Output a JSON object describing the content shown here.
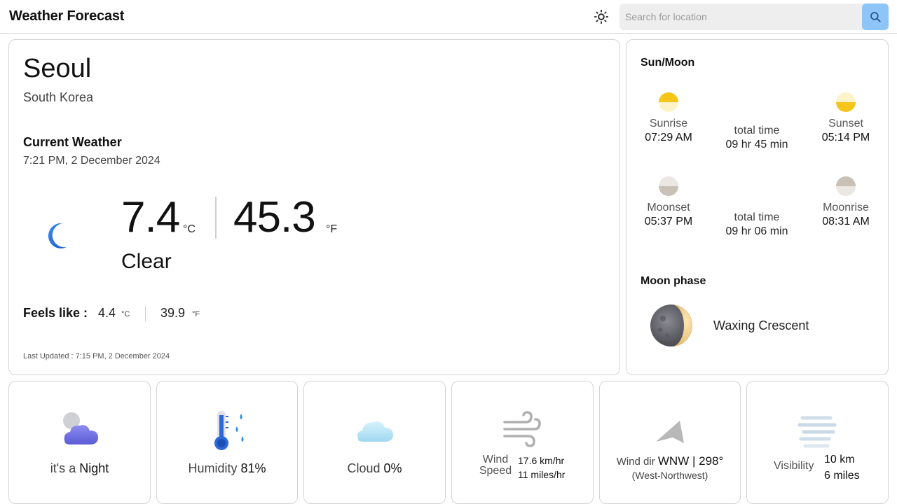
{
  "app": {
    "title": "Weather Forecast"
  },
  "header": {
    "theme_icon": "sun-icon",
    "search_placeholder": "Search for location",
    "search_icon": "search-icon",
    "search_button_color": "#8ec5f8"
  },
  "current": {
    "city": "Seoul",
    "country": "South Korea",
    "heading": "Current Weather",
    "datetime": "7:21 PM, 2 December 2024",
    "condition_icon": "crescent-moon-icon",
    "temp_c": "7.4",
    "unit_c": "°C",
    "temp_f": "45.3",
    "unit_f": "°F",
    "condition": "Clear",
    "feels_label": "Feels like :",
    "feels_c": "4.4",
    "feels_c_unit": "°C",
    "feels_f": "39.9",
    "feels_f_unit": "°F",
    "last_updated": "Last Updated : 7:15 PM, 2 December 2024"
  },
  "astro": {
    "heading": "Sun/Moon",
    "sunrise_label": "Sunrise",
    "sunrise": "07:29 AM",
    "sun_total_label": "total time",
    "sun_total": "09 hr 45 min",
    "sunset_label": "Sunset",
    "sunset": "05:14 PM",
    "moonset_label": "Moonset",
    "moonset": "05:37 PM",
    "moon_total_label": "total time",
    "moon_total": "09 hr 06 min",
    "moonrise_label": "Moonrise",
    "moonrise": "08:31 AM",
    "moon_phase_heading": "Moon phase",
    "moon_phase": "Waxing Crescent",
    "sun_color": "#f5c518",
    "moon_color": "#c9c1b6"
  },
  "tiles": {
    "daynight": {
      "icon": "night-cloud-icon",
      "prefix": "it's a",
      "value": "Night"
    },
    "humidity": {
      "icon": "thermometer-humidity-icon",
      "label": "Humidity",
      "value": "81%"
    },
    "cloud": {
      "icon": "cloud-icon",
      "label": "Cloud",
      "value": "0%"
    },
    "wind": {
      "icon": "wind-icon",
      "label_line1": "Wind",
      "label_line2": "Speed",
      "kmh": "17.6 km/hr",
      "mph": "11 miles/hr"
    },
    "wind_dir": {
      "icon": "direction-arrow-icon",
      "label": "Wind dir",
      "value": "WNW | 298°",
      "full": "(West-Northwest)"
    },
    "visibility": {
      "icon": "fog-icon",
      "label": "Visibility",
      "km": "10 km",
      "miles": "6 miles"
    }
  }
}
